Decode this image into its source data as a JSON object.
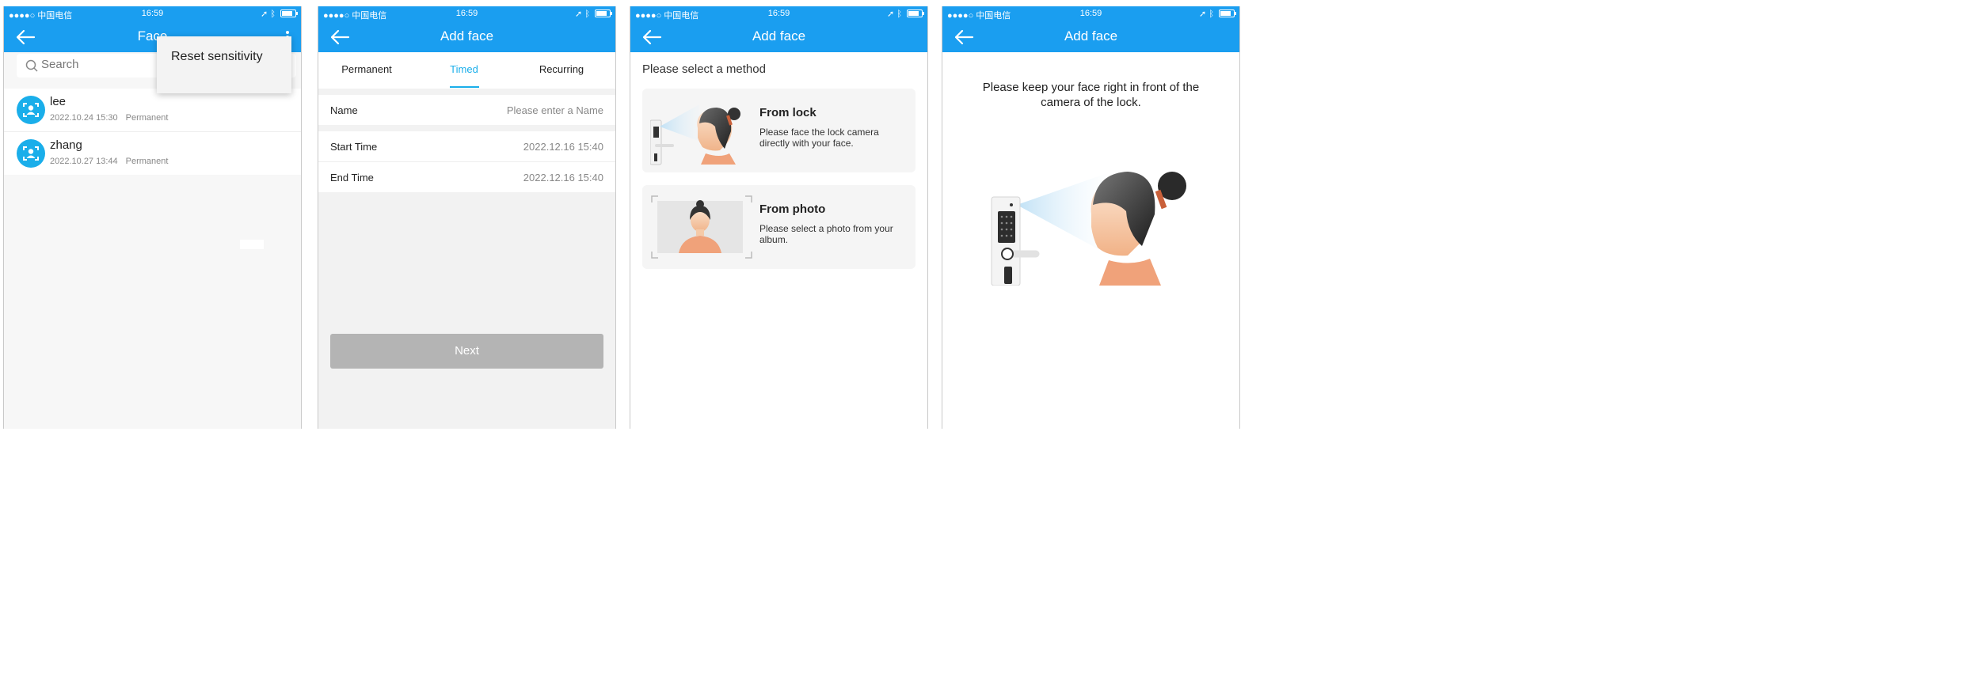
{
  "status_bar": {
    "carrier": "●●●●○ 中国电信",
    "time": "16:59"
  },
  "screen1": {
    "title": "Face",
    "search_placeholder": "Search",
    "menu": {
      "reset_sensitivity": "Reset sensitivity"
    },
    "faces": [
      {
        "name": "lee",
        "date": "2022.10.24 15:30",
        "type": "Permanent"
      },
      {
        "name": "zhang",
        "date": "2022.10.27 13:44",
        "type": "Permanent"
      }
    ]
  },
  "screen2": {
    "title": "Add face",
    "tabs": [
      "Permanent",
      "Timed",
      "Recurring"
    ],
    "active_tab": "Timed",
    "name_label": "Name",
    "name_placeholder": "Please enter a Name",
    "start_label": "Start Time",
    "start_value": "2022.12.16 15:40",
    "end_label": "End Time",
    "end_value": "2022.12.16 15:40",
    "next_label": "Next"
  },
  "screen3": {
    "title": "Add face",
    "prompt": "Please select a method",
    "methods": [
      {
        "title": "From lock",
        "desc": "Please face the lock camera directly with your face."
      },
      {
        "title": "From photo",
        "desc": "Please select a photo from your album."
      }
    ]
  },
  "screen4": {
    "title": "Add face",
    "instruction": "Please keep your face right in front of the camera of the lock."
  },
  "colors": {
    "header_blue": "#1a9ef0",
    "accent_cyan": "#1aaeea",
    "button_disabled": "#b4b4b4"
  },
  "icons": [
    "back-arrow-icon",
    "more-vertical-icon",
    "search-icon",
    "face-scan-icon",
    "wifi-icon",
    "location-icon",
    "bluetooth-icon",
    "battery-icon"
  ]
}
